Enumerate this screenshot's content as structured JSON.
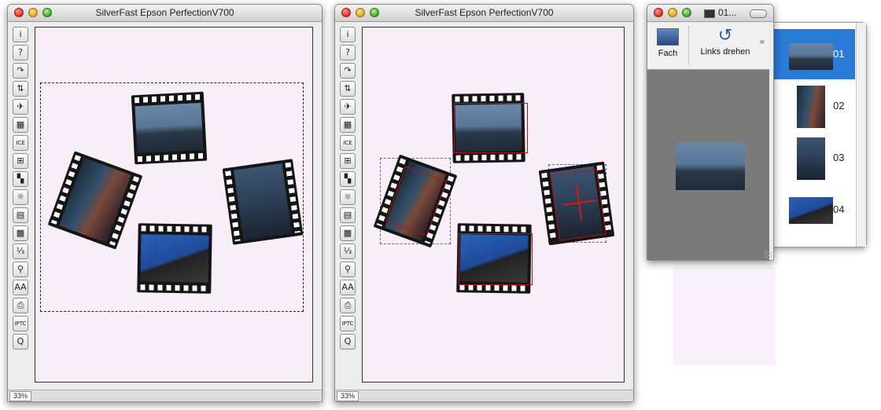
{
  "window_left": {
    "title": "SilverFast Epson PerfectionV700",
    "zoom": "33%"
  },
  "window_right": {
    "title": "SilverFast Epson PerfectionV700",
    "zoom": "33%"
  },
  "toolbar_buttons": [
    {
      "name": "info-button",
      "glyph": "i"
    },
    {
      "name": "help-button",
      "glyph": "?"
    },
    {
      "name": "rotate-button",
      "glyph": "↷"
    },
    {
      "name": "mirror-button",
      "glyph": "⇅"
    },
    {
      "name": "airplane-icon-button",
      "glyph": "✈"
    },
    {
      "name": "grain-button",
      "glyph": "▦"
    },
    {
      "name": "ice-button",
      "glyph": "ICE"
    },
    {
      "name": "negfix-button",
      "glyph": "⊞"
    },
    {
      "name": "color-button",
      "glyph": "▚"
    },
    {
      "name": "sun-button",
      "glyph": "☼"
    },
    {
      "name": "grid-button",
      "glyph": "▤"
    },
    {
      "name": "palette-button",
      "glyph": "▩"
    },
    {
      "name": "ruler-button",
      "glyph": "⅓"
    },
    {
      "name": "stamp-button",
      "glyph": "⚲"
    },
    {
      "name": "text-button",
      "glyph": "AA"
    },
    {
      "name": "print-button",
      "glyph": "⎙"
    },
    {
      "name": "iptc-button",
      "glyph": "IPTC"
    },
    {
      "name": "quicktime-button",
      "glyph": "Q"
    }
  ],
  "panel": {
    "title": "01...",
    "tool1_label": "Fach",
    "tool2_label": "Links drehen"
  },
  "frames": [
    {
      "label": "01",
      "selected": true
    },
    {
      "label": "02",
      "selected": false
    },
    {
      "label": "03",
      "selected": false
    },
    {
      "label": "04",
      "selected": false
    }
  ],
  "colors": {
    "canvas": "#f7eef8",
    "selection": "#b3131a",
    "list_selected": "#2a7ad8"
  }
}
